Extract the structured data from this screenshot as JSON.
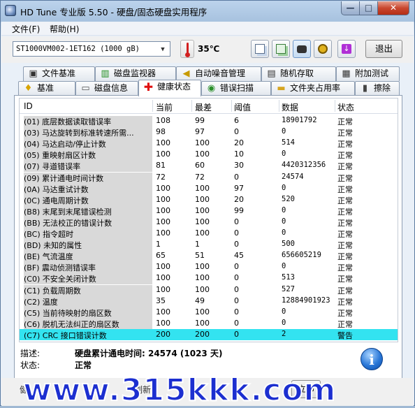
{
  "window": {
    "title": "HD Tune 专业版 5.50 - 硬盘/固态硬盘实用程序",
    "min_label": "—",
    "max_label": "□",
    "close_label": "✕"
  },
  "menu": {
    "file": "文件(F)",
    "help": "帮助(H)"
  },
  "toolbar": {
    "drive": "ST1000VM002-1ET162 (1000 gB)",
    "temperature": "35℃",
    "exit_label": "退出",
    "buttons": [
      "copy-text-icon",
      "copy-info-icon",
      "camera-icon",
      "options-icon",
      "save-icon"
    ]
  },
  "tabs_top": [
    {
      "label": "文件基准",
      "icon": "file-benchmark-icon"
    },
    {
      "label": "磁盘监视器",
      "icon": "disk-monitor-icon"
    },
    {
      "label": "自动噪音管理",
      "icon": "speaker-icon"
    },
    {
      "label": "随机存取",
      "icon": "random-access-icon"
    },
    {
      "label": "附加测试",
      "icon": "extra-tests-icon"
    }
  ],
  "tabs_bottom": [
    {
      "label": "基准",
      "icon": "benchmark-icon"
    },
    {
      "label": "磁盘信息",
      "icon": "disk-info-icon"
    },
    {
      "label": "健康状态",
      "icon": "health-cross-icon",
      "active": true
    },
    {
      "label": "错误扫描",
      "icon": "error-scan-icon"
    },
    {
      "label": "文件夹占用率",
      "icon": "folder-usage-icon"
    },
    {
      "label": "擦除",
      "icon": "erase-icon"
    }
  ],
  "table": {
    "headers": {
      "id": "ID",
      "current": "当前",
      "worst": "最差",
      "threshold": "阈值",
      "data": "数据",
      "status": "状态"
    },
    "rows": [
      {
        "id": "(01) 底层数据读取错误率",
        "current": "108",
        "worst": "99",
        "threshold": "6",
        "data": "18901792",
        "status": "正常"
      },
      {
        "id": "(03) 马达旋转到标准转速所需...",
        "current": "98",
        "worst": "97",
        "threshold": "0",
        "data": "0",
        "status": "正常"
      },
      {
        "id": "(04) 马达启动/停止计数",
        "current": "100",
        "worst": "100",
        "threshold": "20",
        "data": "514",
        "status": "正常"
      },
      {
        "id": "(05) 重映射扇区计数",
        "current": "100",
        "worst": "100",
        "threshold": "10",
        "data": "0",
        "status": "正常"
      },
      {
        "id": "(07) 寻道错误率",
        "current": "81",
        "worst": "60",
        "threshold": "30",
        "data": "4420312356",
        "status": "正常"
      },
      {
        "id": "(09) 累计通电时间计数",
        "current": "72",
        "worst": "72",
        "threshold": "0",
        "data": "24574",
        "status": "正常"
      },
      {
        "id": "(0A) 马达重试计数",
        "current": "100",
        "worst": "100",
        "threshold": "97",
        "data": "0",
        "status": "正常"
      },
      {
        "id": "(0C) 通电周期计数",
        "current": "100",
        "worst": "100",
        "threshold": "20",
        "data": "520",
        "status": "正常"
      },
      {
        "id": "(B8) 末尾到末尾错误检测",
        "current": "100",
        "worst": "100",
        "threshold": "99",
        "data": "0",
        "status": "正常"
      },
      {
        "id": "(BB) 无法校正的错误计数",
        "current": "100",
        "worst": "100",
        "threshold": "0",
        "data": "0",
        "status": "正常"
      },
      {
        "id": "(BC) 指令超时",
        "current": "100",
        "worst": "100",
        "threshold": "0",
        "data": "0",
        "status": "正常"
      },
      {
        "id": "(BD) 未知的属性",
        "current": "1",
        "worst": "1",
        "threshold": "0",
        "data": "500",
        "status": "正常"
      },
      {
        "id": "(BE) 气流温度",
        "current": "65",
        "worst": "51",
        "threshold": "45",
        "data": "656605219",
        "status": "正常"
      },
      {
        "id": "(BF) 震动侦测错误率",
        "current": "100",
        "worst": "100",
        "threshold": "0",
        "data": "0",
        "status": "正常"
      },
      {
        "id": "(C0) 不安全关闭计数",
        "current": "100",
        "worst": "100",
        "threshold": "0",
        "data": "513",
        "status": "正常"
      },
      {
        "id": "(C1) 负载周期数",
        "current": "100",
        "worst": "100",
        "threshold": "0",
        "data": "527",
        "status": "正常"
      },
      {
        "id": "(C2) 温度",
        "current": "35",
        "worst": "49",
        "threshold": "0",
        "data": "12884901923",
        "status": "正常"
      },
      {
        "id": "(C5) 当前待映射的扇区数",
        "current": "100",
        "worst": "100",
        "threshold": "0",
        "data": "0",
        "status": "正常"
      },
      {
        "id": "(C6) 脱机无法纠正的扇区数",
        "current": "100",
        "worst": "100",
        "threshold": "0",
        "data": "0",
        "status": "正常"
      },
      {
        "id": "(C7) CRC 接口错误计数",
        "current": "200",
        "worst": "200",
        "threshold": "0",
        "data": "2",
        "status": "警告",
        "selected": true
      }
    ]
  },
  "details": {
    "desc_label": "描述:",
    "desc_value": "硬盘累计通电时间: 24574 (1023 天)",
    "status_label": "状态:",
    "status_value": "正常"
  },
  "bottom": {
    "left_text": "健",
    "mid_text": "刷新",
    "button_label": "立即"
  },
  "watermark": "www.315kkk.com",
  "colors": {
    "selected_row": "#33e3f0",
    "watermark": "#1c2fd0"
  }
}
